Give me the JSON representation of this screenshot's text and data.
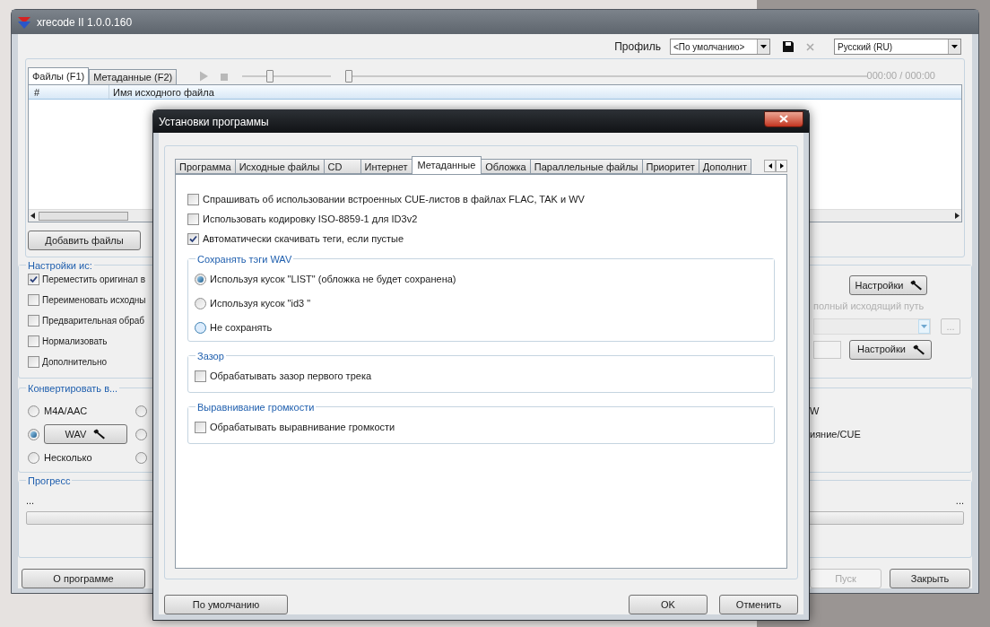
{
  "main_window": {
    "title": "xrecode II 1.0.0.160",
    "profile": {
      "label": "Профиль",
      "value": "<По умолчанию>"
    },
    "language": {
      "value": "Русский (RU)"
    },
    "tabs": [
      {
        "label": "Файлы (F1)",
        "selected": true
      },
      {
        "label": "Метаданные (F2)",
        "selected": false
      }
    ],
    "volume": {
      "level": 0.3
    },
    "seek": {
      "level": 0
    },
    "time": "000:00 / 000:00",
    "file_list": {
      "columns": [
        "#",
        "Имя исходного файла"
      ]
    },
    "add_files_button": "Добавить файлы",
    "source_settings": {
      "title": "Настройки ис:",
      "options": [
        {
          "label": "Переместить оригинал в",
          "checked": true
        },
        {
          "label": "Переименовать исходны",
          "checked": false
        },
        {
          "label": "Предварительная обраб",
          "checked": false
        },
        {
          "label": "Нормализовать",
          "checked": false
        },
        {
          "label": "Дополнительно",
          "checked": false
        }
      ],
      "settings_button": "Настройки",
      "output_path_hint": "полный исходящий путь",
      "browse_button": "...",
      "settings_button_2": "Настройки"
    },
    "convert_to": {
      "title": "Конвертировать в...",
      "formats": [
        {
          "label": "M4A/AAC",
          "selected": false,
          "kind": "plain"
        },
        {
          "label": "WAV",
          "selected": true,
          "kind": "button"
        },
        {
          "label": "Несколько",
          "selected": false,
          "kind": "plain"
        }
      ],
      "column_2": [
        {
          "selected": false
        },
        {
          "selected": false
        },
        {
          "selected": false
        }
      ],
      "column_3": [
        "W",
        "ияние/CUE"
      ]
    },
    "progress": {
      "title": "Прогресс",
      "status_left": "...",
      "status_right": "...",
      "level": 0
    },
    "buttons": {
      "about": "О программе",
      "start": {
        "label": "Пуск",
        "disabled": true
      },
      "close": "Закрыть"
    }
  },
  "dialog": {
    "title": "Установки программы",
    "tabs": [
      {
        "label": "Программа",
        "selected": false
      },
      {
        "label": "Исходные файлы",
        "selected": false
      },
      {
        "label": "CD",
        "selected": false
      },
      {
        "label": "Интернет",
        "selected": false
      },
      {
        "label": "Метаданные",
        "selected": true
      },
      {
        "label": "Обложка",
        "selected": false
      },
      {
        "label": "Параллельные файлы",
        "selected": false
      },
      {
        "label": "Приоритет",
        "selected": false
      },
      {
        "label": "Дополнит",
        "selected": false
      }
    ],
    "options": [
      {
        "label": "Спрашивать об использовании встроенных CUE-листов в файлах FLAC, TAK и WV",
        "checked": false
      },
      {
        "label": "Использовать кодировку ISO-8859-1 для ID3v2",
        "checked": false
      },
      {
        "label": "Автоматически скачивать теги, если пустые",
        "checked": true
      }
    ],
    "wav_tags": {
      "title": "Сохранять тэги WAV",
      "options": [
        {
          "label": "Используя кусок \"LIST\" (обложка не будет сохранена)",
          "selected": true
        },
        {
          "label": "Используя кусок \"id3 \"",
          "selected": false
        },
        {
          "label": "Не сохранять",
          "selected": false
        }
      ]
    },
    "gap": {
      "title": "Зазор",
      "options": [
        {
          "label": "Обрабатывать зазор первого трека",
          "checked": false
        }
      ]
    },
    "loudness": {
      "title": "Выравнивание громкости",
      "options": [
        {
          "label": "Обрабатывать выравнивание громкости",
          "checked": false
        }
      ]
    },
    "buttons": {
      "defaults": "По умолчанию",
      "ok": "OK",
      "cancel": "Отменить"
    }
  }
}
